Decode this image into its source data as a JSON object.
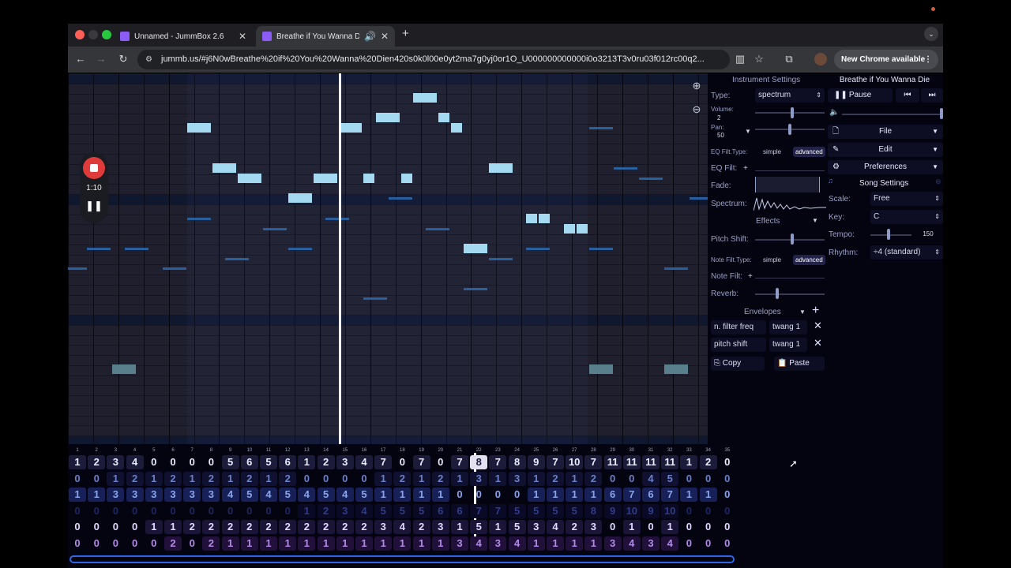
{
  "browser": {
    "tabs": [
      {
        "title": "Unnamed - JummBox 2.6",
        "active": false
      },
      {
        "title": "Breathe if You Wanna Die",
        "active": true
      }
    ],
    "new_tab": "+",
    "url": "jummb.us/#j6N0wBreathe%20if%20You%20Wanna%20Dien420s0k0l00e0yt2ma7g0yj0or1O_U000000000000i0o3213T3v0ru03f012rc00q2...",
    "new_chrome": "New Chrome available"
  },
  "recording": {
    "time": "1:10"
  },
  "instrument": {
    "header": "Instrument Settings",
    "type_label": "Type:",
    "type_value": "spectrum",
    "volume_label": "Volume:",
    "volume_value": "2",
    "pan_label": "Pan:",
    "pan_value": "50",
    "eq_type_label": "EQ Filt.Type:",
    "simple": "simple",
    "advanced": "advanced",
    "eq_filt_label": "EQ Filt:",
    "plus": "+",
    "fade_label": "Fade:",
    "spectrum_label": "Spectrum:",
    "effects_label": "Effects",
    "pitch_shift_label": "Pitch Shift:",
    "note_filt_type_label": "Note Filt.Type:",
    "note_filt_label": "Note Filt:",
    "reverb_label": "Reverb:",
    "envelopes_label": "Envelopes",
    "envelopes": [
      {
        "target": "n. filter freq",
        "shape": "twang 1"
      },
      {
        "target": "pitch shift",
        "shape": "twang 1"
      }
    ],
    "copy_label": "Copy",
    "paste_label": "Paste"
  },
  "song": {
    "title": "Breathe if You Wanna Die",
    "pause_label": "Pause",
    "file_label": "File",
    "edit_label": "Edit",
    "preferences_label": "Preferences",
    "settings_label": "Song Settings",
    "scale_label": "Scale:",
    "scale_value": "Free",
    "key_label": "Key:",
    "key_value": "C",
    "tempo_label": "Tempo:",
    "tempo_value": "150",
    "rhythm_label": "Rhythm:",
    "rhythm_value": "÷4 (standard)"
  },
  "pattern": {
    "bar_numbers": [
      "1",
      "2",
      "3",
      "4",
      "5",
      "6",
      "7",
      "8",
      "9",
      "10",
      "11",
      "12",
      "13",
      "14",
      "15",
      "16",
      "17",
      "18",
      "19",
      "20",
      "21",
      "22",
      "23",
      "24",
      "25",
      "26",
      "27",
      "28",
      "29",
      "30",
      "31",
      "32",
      "33",
      "34",
      "35"
    ],
    "rows": [
      [
        "1",
        "2",
        "3",
        "4",
        "0",
        "0",
        "0",
        "0",
        "5",
        "6",
        "5",
        "6",
        "1",
        "2",
        "3",
        "4",
        "7",
        "0",
        "7",
        "0",
        "7",
        "8",
        "7",
        "8",
        "9",
        "7",
        "10",
        "7",
        "11",
        "11",
        "11",
        "11",
        "1",
        "2",
        "0"
      ],
      [
        "0",
        "0",
        "1",
        "2",
        "1",
        "2",
        "1",
        "2",
        "1",
        "2",
        "1",
        "2",
        "0",
        "0",
        "0",
        "0",
        "1",
        "2",
        "1",
        "2",
        "1",
        "3",
        "1",
        "3",
        "1",
        "2",
        "1",
        "2",
        "0",
        "0",
        "4",
        "5",
        "0",
        "0",
        "0"
      ],
      [
        "1",
        "1",
        "3",
        "3",
        "3",
        "3",
        "3",
        "3",
        "4",
        "5",
        "4",
        "5",
        "4",
        "5",
        "4",
        "5",
        "1",
        "1",
        "1",
        "1",
        "0",
        "0",
        "0",
        "0",
        "1",
        "1",
        "1",
        "1",
        "6",
        "7",
        "6",
        "7",
        "1",
        "1",
        "0"
      ],
      [
        "0",
        "0",
        "0",
        "0",
        "0",
        "0",
        "0",
        "0",
        "0",
        "0",
        "0",
        "0",
        "1",
        "2",
        "3",
        "4",
        "5",
        "5",
        "5",
        "6",
        "6",
        "7",
        "7",
        "5",
        "5",
        "5",
        "5",
        "8",
        "9",
        "10",
        "9",
        "10",
        "0",
        "0",
        "0"
      ],
      [
        "0",
        "0",
        "0",
        "0",
        "1",
        "1",
        "2",
        "2",
        "2",
        "2",
        "2",
        "2",
        "2",
        "2",
        "2",
        "2",
        "3",
        "4",
        "2",
        "3",
        "1",
        "5",
        "1",
        "5",
        "3",
        "4",
        "2",
        "3",
        "0",
        "1",
        "0",
        "1",
        "0",
        "0",
        "0"
      ],
      [
        "0",
        "0",
        "0",
        "0",
        "0",
        "2",
        "0",
        "2",
        "1",
        "1",
        "1",
        "1",
        "1",
        "1",
        "1",
        "1",
        "1",
        "1",
        "1",
        "1",
        "3",
        "4",
        "3",
        "4",
        "1",
        "1",
        "1",
        "1",
        "3",
        "4",
        "3",
        "4",
        "0",
        "0",
        "0"
      ]
    ]
  }
}
